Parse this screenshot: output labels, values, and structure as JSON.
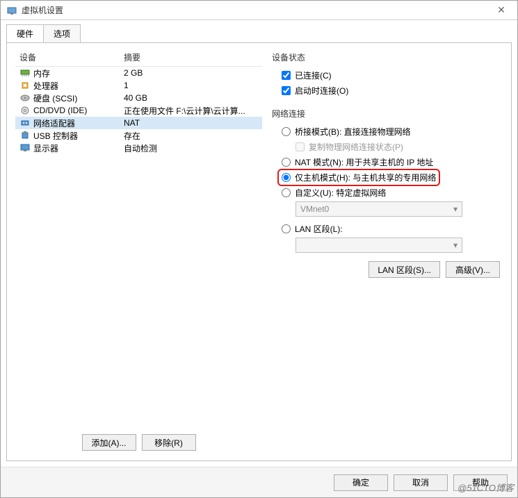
{
  "window": {
    "title": "虚拟机设置"
  },
  "tabs": {
    "hardware": "硬件",
    "options": "选项"
  },
  "hw_table": {
    "col_device": "设备",
    "col_summary": "摘要",
    "rows": [
      {
        "icon": "memory",
        "label": "内存",
        "summary": "2 GB",
        "selected": false
      },
      {
        "icon": "cpu",
        "label": "处理器",
        "summary": "1",
        "selected": false
      },
      {
        "icon": "disk",
        "label": "硬盘 (SCSI)",
        "summary": "40 GB",
        "selected": false
      },
      {
        "icon": "cd",
        "label": "CD/DVD (IDE)",
        "summary": "正在使用文件 F:\\云计算\\云计算...",
        "selected": false
      },
      {
        "icon": "net",
        "label": "网络适配器",
        "summary": "NAT",
        "selected": true
      },
      {
        "icon": "usb",
        "label": "USB 控制器",
        "summary": "存在",
        "selected": false
      },
      {
        "icon": "display",
        "label": "显示器",
        "summary": "自动检测",
        "selected": false
      }
    ]
  },
  "left_buttons": {
    "add": "添加(A)...",
    "remove": "移除(R)"
  },
  "device_status": {
    "title": "设备状态",
    "connected": "已连接(C)",
    "connect_at_poweron": "启动时连接(O)"
  },
  "net_conn": {
    "title": "网络连接",
    "bridged": "桥接模式(B): 直接连接物理网络",
    "replicate": "复制物理网络连接状态(P)",
    "nat": "NAT 模式(N): 用于共享主机的 IP 地址",
    "hostonly": "仅主机模式(H): 与主机共享的专用网络",
    "custom": "自定义(U): 特定虚拟网络",
    "vmnet_value": "VMnet0",
    "lanseg": "LAN 区段(L):",
    "lanseg_value": ""
  },
  "right_buttons": {
    "lan_segments": "LAN 区段(S)...",
    "advanced": "高级(V)..."
  },
  "footer": {
    "ok": "确定",
    "cancel": "取消",
    "help": "帮助"
  },
  "watermark": "@51CTO博客"
}
